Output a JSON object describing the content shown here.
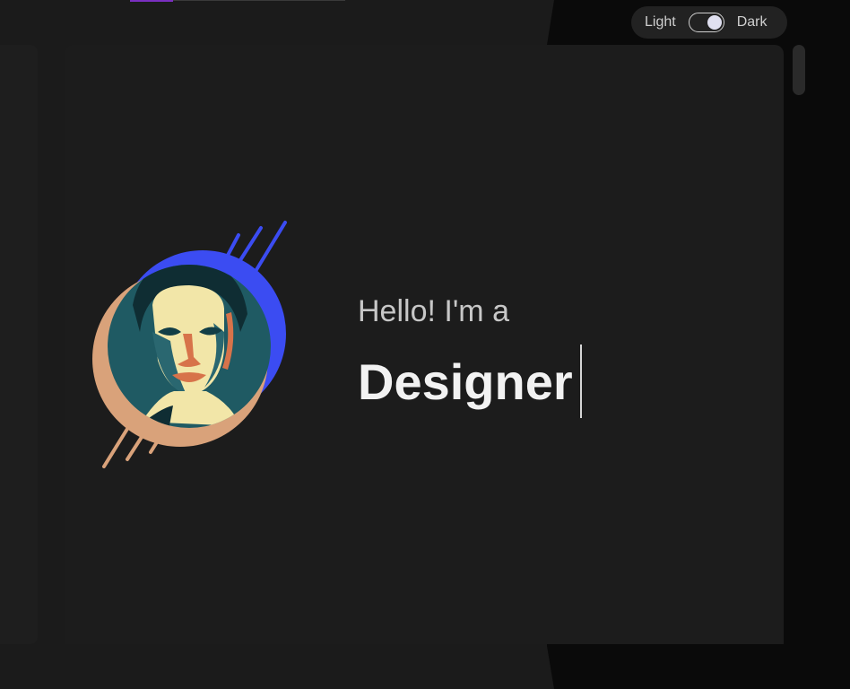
{
  "theme_switch": {
    "light_label": "Light",
    "dark_label": "Dark",
    "selected": "Dark"
  },
  "hero": {
    "greeting": "Hello! I'm a",
    "role": "Designer",
    "avatar_icon": "profile-portrait"
  },
  "colors": {
    "accent_blue": "#3b4cf2",
    "accent_peach": "#d9a27a",
    "portrait_teal": "#1f5a63",
    "accent_purple": "#7a2fc0"
  }
}
